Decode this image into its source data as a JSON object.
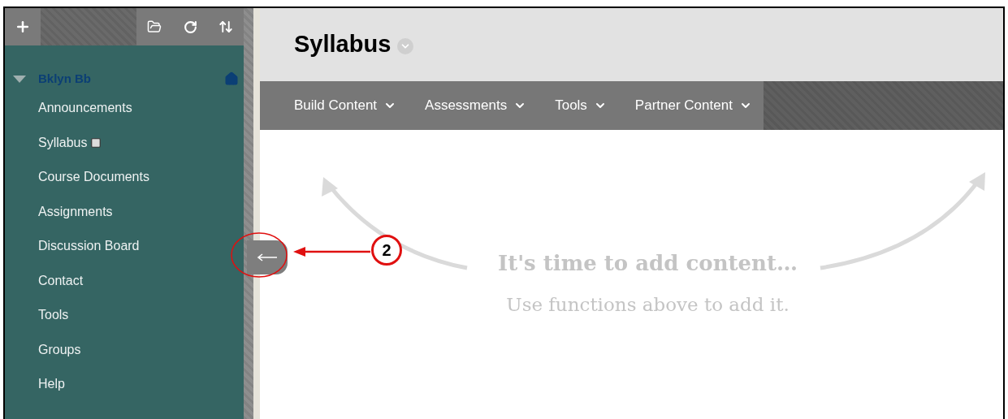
{
  "sidebar": {
    "course": {
      "title": "Bklyn Bb",
      "expanded": true
    },
    "items": [
      {
        "label": "Announcements",
        "kind": "link"
      },
      {
        "label": "Syllabus",
        "kind": "link-with-icon"
      },
      {
        "label": "Course Documents",
        "kind": "link"
      },
      {
        "label": "Assignments",
        "kind": "link"
      },
      {
        "label": "Discussion Board",
        "kind": "link"
      },
      {
        "label": "Contact",
        "kind": "link"
      },
      {
        "label": "Tools",
        "kind": "link"
      },
      {
        "label": "Groups",
        "kind": "link"
      },
      {
        "label": "Help",
        "kind": "link"
      }
    ]
  },
  "page": {
    "title": "Syllabus"
  },
  "toolbar": [
    {
      "label": "Build Content"
    },
    {
      "label": "Assessments"
    },
    {
      "label": "Tools"
    },
    {
      "label": "Partner Content"
    }
  ],
  "empty_state": {
    "heading": "It's time to add content…",
    "hint": "Use functions above to add it."
  },
  "callout": {
    "number": "2"
  }
}
